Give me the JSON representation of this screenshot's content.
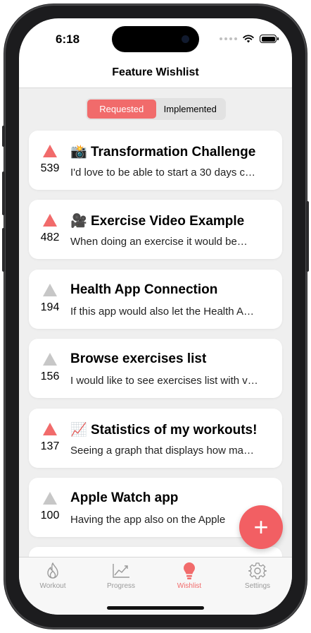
{
  "status_bar": {
    "time": "6:18"
  },
  "nav": {
    "title": "Feature Wishlist"
  },
  "segmented": {
    "options": [
      "Requested",
      "Implemented"
    ],
    "selected": "Requested"
  },
  "features": [
    {
      "emoji": "📸",
      "title": "Transformation Challenge",
      "description": "I'd love to be able to start a 30 days c…",
      "votes": "539",
      "voted": true
    },
    {
      "emoji": "🎥",
      "title": "Exercise Video Example",
      "description": "When doing an exercise it would be…",
      "votes": "482",
      "voted": true
    },
    {
      "emoji": "",
      "title": "Health App Connection",
      "description": "If this app would also let the Health A…",
      "votes": "194",
      "voted": false
    },
    {
      "emoji": "",
      "title": "Browse exercises list",
      "description": "I would like to see exercises list with v…",
      "votes": "156",
      "voted": false
    },
    {
      "emoji": "📈",
      "title": "Statistics of my workouts!",
      "description": "Seeing a graph that displays how ma…",
      "votes": "137",
      "voted": true
    },
    {
      "emoji": "",
      "title": "Apple Watch app",
      "description": "Having the app also on the Apple",
      "votes": "100",
      "voted": false
    }
  ],
  "fab": {
    "label": "+"
  },
  "tabs": [
    {
      "label": "Workout",
      "icon": "flame-icon"
    },
    {
      "label": "Progress",
      "icon": "chart-icon"
    },
    {
      "label": "Wishlist",
      "icon": "lightbulb-icon",
      "active": true
    },
    {
      "label": "Settings",
      "icon": "gear-icon"
    }
  ],
  "colors": {
    "accent": "#f16b6b",
    "fab": "#f25f63",
    "inactive": "#9a9a9a",
    "vote_inactive": "#c7c7c7",
    "background": "#efefef"
  }
}
